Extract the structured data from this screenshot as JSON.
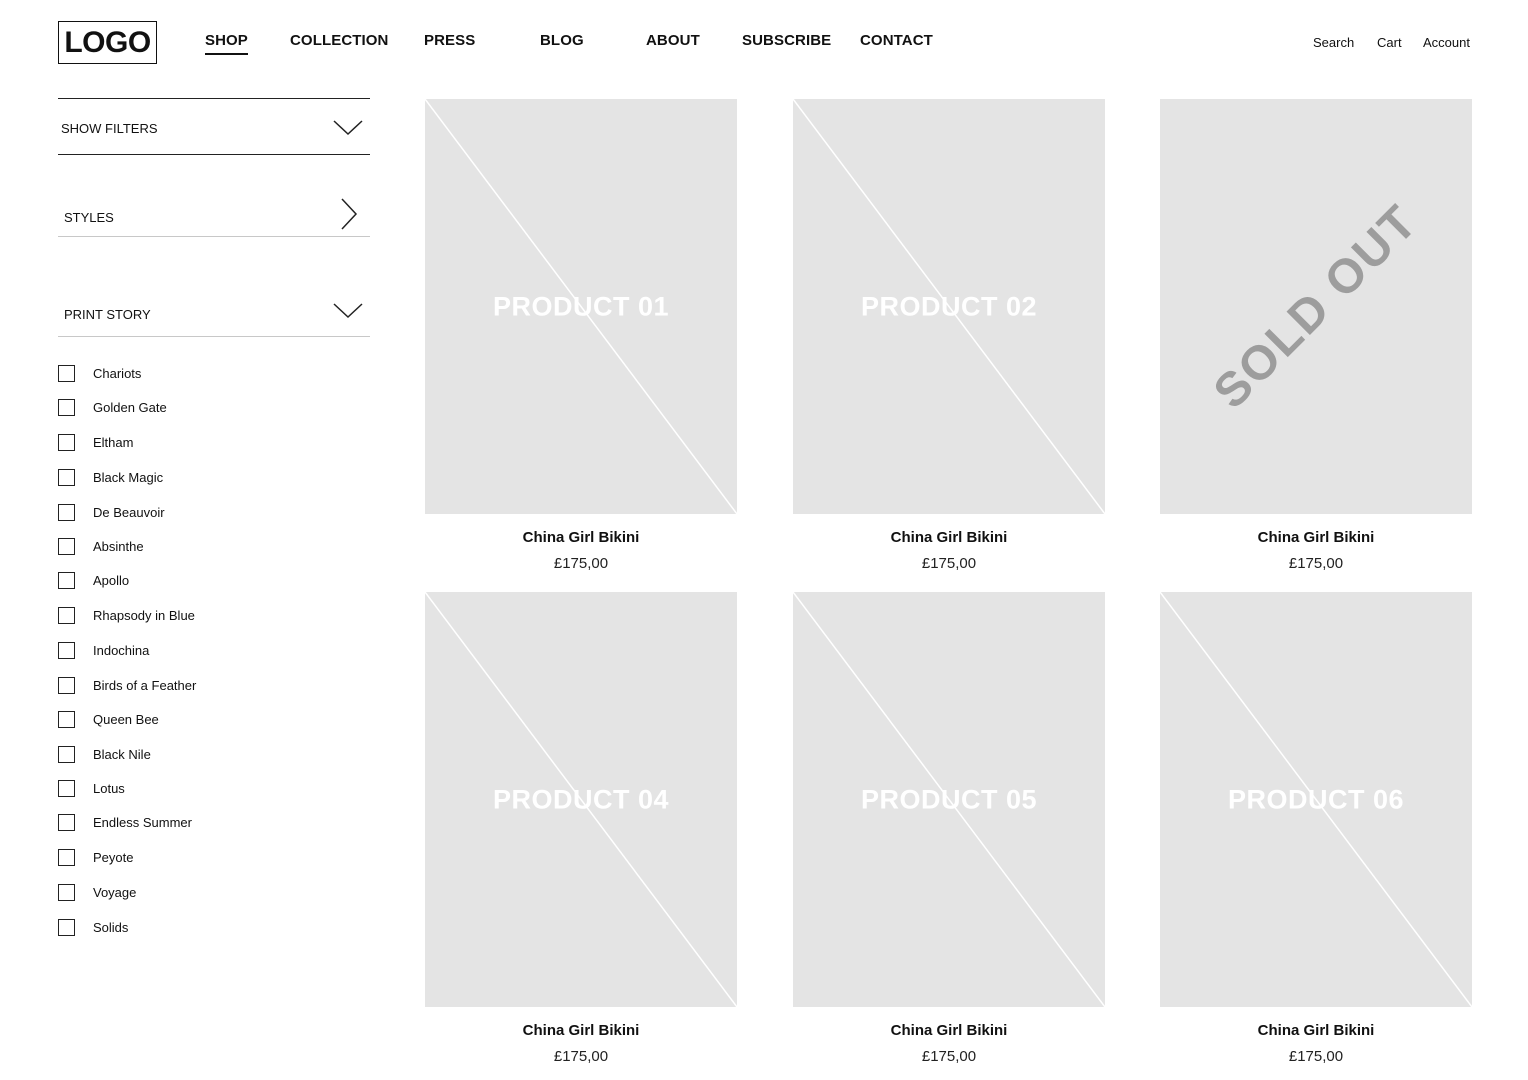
{
  "header": {
    "logo": "LOGO",
    "nav": [
      "SHOP",
      "COLLECTION",
      "PRESS",
      "BLOG",
      "ABOUT",
      "SUBSCRIBE",
      "CONTACT"
    ],
    "active_nav": "SHOP",
    "utility": [
      "Search",
      "Cart",
      "Account"
    ]
  },
  "sidebar": {
    "show_filters": "SHOW FILTERS",
    "styles": "STYLES",
    "print_story": "PRINT STORY",
    "print_options": [
      "Chariots",
      "Golden Gate",
      "Eltham",
      "Black Magic",
      "De Beauvoir",
      "Absinthe",
      "Apollo",
      "Rhapsody in Blue",
      "Indochina",
      "Birds of a Feather",
      "Queen Bee",
      "Black Nile",
      "Lotus",
      "Endless Summer",
      "Peyote",
      "Voyage",
      "Solids"
    ]
  },
  "products": [
    {
      "placeholder": "PRODUCT 01",
      "name": "China Girl Bikini",
      "price": "£175,00"
    },
    {
      "placeholder": "PRODUCT 02",
      "name": "China Girl Bikini",
      "price": "£175,00"
    },
    {
      "placeholder": "SOLD OUT",
      "name": "China Girl Bikini",
      "price": "£175,00",
      "sold_out": true
    },
    {
      "placeholder": "PRODUCT 04",
      "name": "China Girl Bikini",
      "price": "£175,00"
    },
    {
      "placeholder": "PRODUCT 05",
      "name": "China Girl Bikini",
      "price": "£175,00"
    },
    {
      "placeholder": "PRODUCT 06",
      "name": "China Girl Bikini",
      "price": "£175,00"
    }
  ],
  "colors": {
    "placeholder_bg": "#e4e4e4",
    "sold_out_text": "#9d9d9d",
    "text": "#111111"
  },
  "icons": {
    "show_filters": "chevron-down-icon",
    "styles": "chevron-right-icon",
    "print_story": "chevron-down-icon"
  }
}
